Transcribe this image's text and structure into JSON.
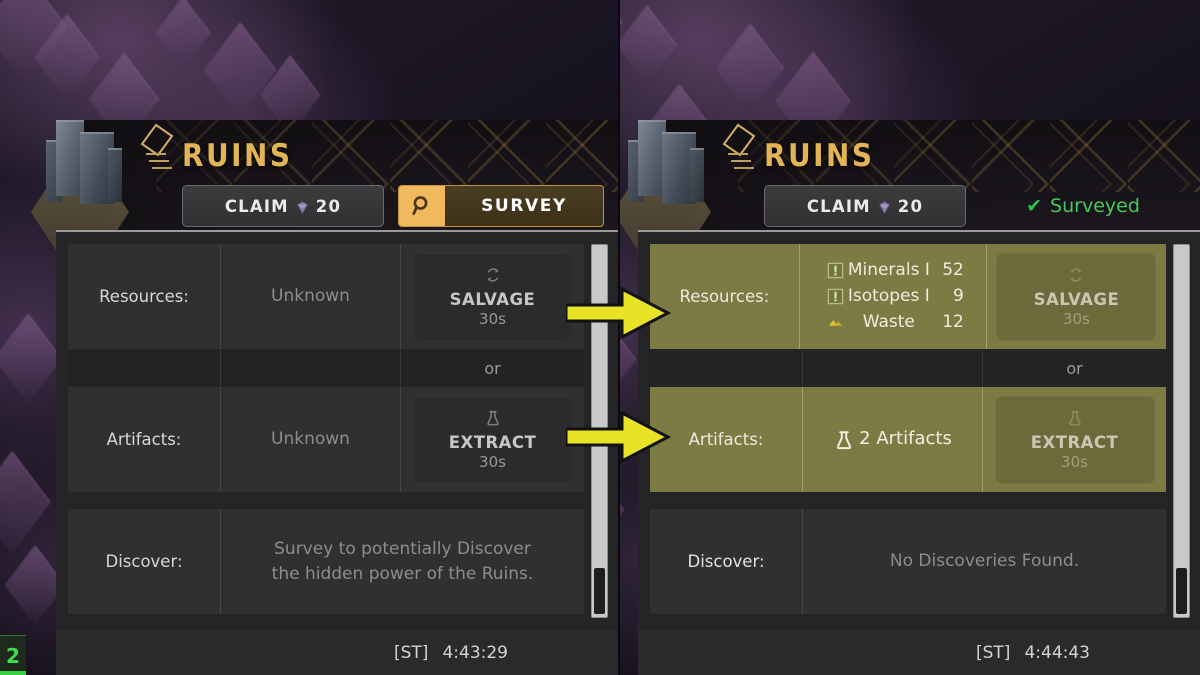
{
  "panels": [
    {
      "id": "before",
      "title": "RUINS",
      "icon_names": {
        "site": "ruins-building-icon",
        "rank": "rank-diamond-icon"
      },
      "claim_button": {
        "label": "CLAIM",
        "cost": "20",
        "currency_icon": "gem-icon"
      },
      "survey_button": {
        "label": "SURVEY",
        "icon": "magnifier-icon"
      },
      "surveyed_status": null,
      "rows": {
        "resources": {
          "label": "Resources:",
          "value": "Unknown",
          "items": []
        },
        "artifacts": {
          "label": "Artifacts:",
          "value": "Unknown"
        },
        "discover": {
          "label": "Discover:",
          "value": "Survey to potentially Discover the hidden power of the Ruins."
        }
      },
      "or_label": "or",
      "salvage": {
        "label": "SALVAGE",
        "time": "30s",
        "icon": "recycle-icon"
      },
      "extract": {
        "label": "EXTRACT",
        "time": "30s",
        "icon": "flask-icon"
      },
      "status": {
        "zone": "[ST]",
        "time": "4:43:29"
      },
      "corner_badge": "2",
      "highlighted": false
    },
    {
      "id": "after",
      "title": "RUINS",
      "icon_names": {
        "site": "ruins-building-icon",
        "rank": "rank-diamond-icon"
      },
      "claim_button": {
        "label": "CLAIM",
        "cost": "20",
        "currency_icon": "gem-icon"
      },
      "survey_button": null,
      "surveyed_status": {
        "label": "Surveyed",
        "check": "✔",
        "color": "#46c95a"
      },
      "rows": {
        "resources": {
          "label": "Resources:",
          "value": null,
          "items": [
            {
              "icon": "minerals-icon",
              "name": "Minerals I",
              "qty": "52"
            },
            {
              "icon": "isotopes-icon",
              "name": "Isotopes I",
              "qty": "9"
            },
            {
              "icon": "waste-icon",
              "name": "Waste",
              "qty": "12"
            }
          ]
        },
        "artifacts": {
          "label": "Artifacts:",
          "value": "2 Artifacts",
          "icon": "flask-icon"
        },
        "discover": {
          "label": "Discover:",
          "value": "No Discoveries Found."
        }
      },
      "or_label": "or",
      "salvage": {
        "label": "SALVAGE",
        "time": "30s",
        "icon": "recycle-icon"
      },
      "extract": {
        "label": "EXTRACT",
        "time": "30s",
        "icon": "flask-icon"
      },
      "status": {
        "zone": "[ST]",
        "time": "4:44:43"
      },
      "corner_badge": null,
      "highlighted": true
    }
  ],
  "annotations": {
    "arrows": [
      {
        "name": "arrow-to-resources",
        "color": "#e8e326"
      },
      {
        "name": "arrow-to-artifacts",
        "color": "#e8e326"
      }
    ]
  },
  "colors": {
    "title_gold": "#e2b457",
    "survey_amber": "#f0b95e",
    "olive_highlight": "#7d7b44",
    "panel_bg": "#252527",
    "row_dark": "#303032",
    "surveyed_green": "#46c95a",
    "arrow_yellow": "#e8e326"
  }
}
